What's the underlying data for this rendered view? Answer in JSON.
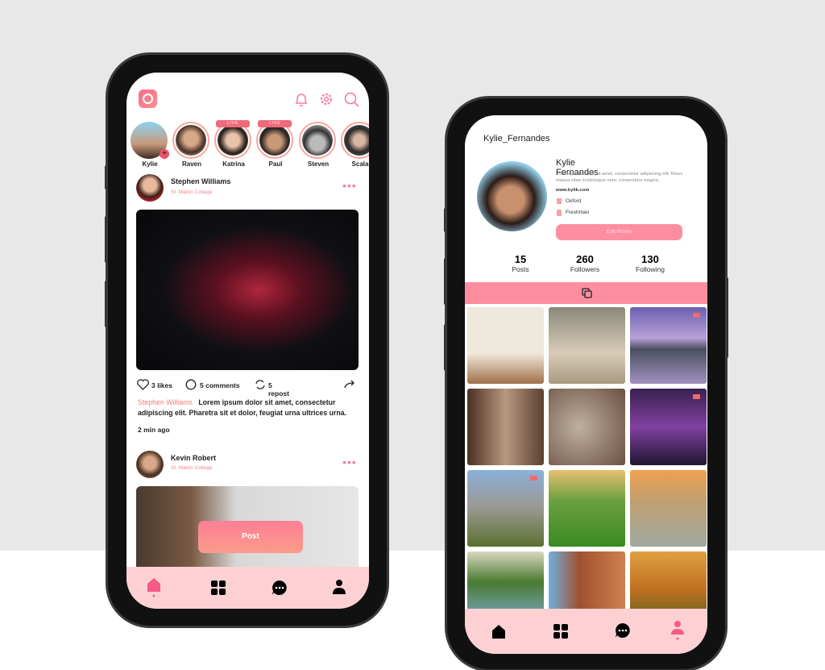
{
  "feed": {
    "header_icons": [
      "app-logo",
      "bell-icon",
      "gear-icon",
      "search-icon"
    ],
    "stories": [
      {
        "name": "Kylie",
        "live": false,
        "own": true
      },
      {
        "name": "Raven",
        "live": false
      },
      {
        "name": "Katrina",
        "live": true
      },
      {
        "name": "Paul",
        "live": true
      },
      {
        "name": "Steven",
        "live": false
      },
      {
        "name": "Scala",
        "live": false
      }
    ],
    "live_label": "LIVE",
    "posts": [
      {
        "author": "Stephen Williams",
        "college": "St. Martin College",
        "likes": "3 likes",
        "comments": "5 comments",
        "reposts": "5 repost",
        "caption_author": "Stephen Williams",
        "caption": "Lorem ipsum dolor sit amet, consectetur adipiscing elit. Pharetra sit et dolor, feugiat urna ultrices urna.",
        "time": "2 min ago"
      },
      {
        "author": "Kevin Robert",
        "college": "St. Martin College"
      }
    ],
    "post_button": "Post",
    "nav": [
      "home-icon",
      "grid-icon",
      "chat-icon",
      "profile-icon"
    ]
  },
  "profile": {
    "username": "Kylie_Fernandes",
    "name": "Kylie Fernandes",
    "bio": "Lorem ipsum dolor sit amet, consectetur adipiscing elit. Risus massa vitae scelerisque nunc consectetur magna",
    "website": "www.kylik.com",
    "school": "Oxford",
    "year": "Freshman",
    "edit_button": "Edit Profile",
    "stats": [
      {
        "value": "15",
        "label": "Posts"
      },
      {
        "value": "260",
        "label": "Followers"
      },
      {
        "value": "130",
        "label": "Following"
      }
    ],
    "accent": "#fd8ea0"
  }
}
